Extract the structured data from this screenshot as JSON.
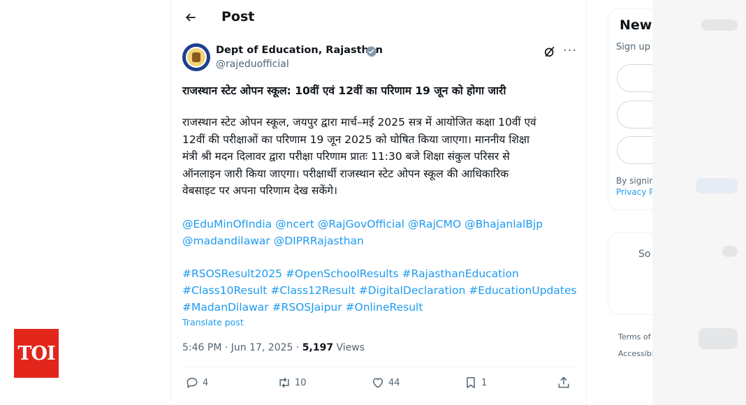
{
  "publisher": {
    "logo_text": "TOI"
  },
  "header": {
    "title": "Post"
  },
  "author": {
    "name": "Dept of Education, Rajasthan",
    "handle": "@rajeduofficial"
  },
  "tweet": {
    "title": "राजस्थान स्टेट ओपन स्कूल: 10वीं एवं 12वीं का परिणाम 19 जून को होगा जारी",
    "body_lines": [
      "राजस्थान स्टेट ओपन स्कूल, जयपुर द्वारा मार्च–मई 2025 सत्र में आयोजित कक्षा 10वीं एवं",
      "12वीं की परीक्षाओं का परिणाम 19 जून 2025 को घोषित किया जाएगा। माननीय शिक्षा",
      "मंत्री श्री मदन दिलावर द्वारा परीक्षा परिणाम प्रातः 11:30 बजे शिक्षा संकुल परिसर से",
      "ऑनलाइन जारी किया जाएगा। परीक्षार्थी राजस्थान स्टेट ओपन स्कूल की आधिकारिक",
      "वेबसाइट पर अपना परिणाम देख सकेंगे।"
    ],
    "mentions": [
      "@EduMinOfIndia",
      "@ncert",
      "@RajGovOfficial",
      "@RajCMO",
      "@BhajanlalBjp",
      "@madandilawar",
      "@DIPRRajasthan"
    ],
    "hashtags": [
      "#RSOSResult2025",
      "#OpenSchoolResults",
      "#RajasthanEducation",
      "#Class10Result",
      "#Class12Result",
      "#DigitalDeclaration",
      "#EducationUpdates",
      "#MadanDilawar",
      "#RSOSJaipur",
      "#OnlineResult"
    ],
    "translate_label": "Translate post",
    "timestamp": "5:46 PM · Jun 17, 2025 · ",
    "views_count": "5,197",
    "views_label": " Views"
  },
  "actions": {
    "replies": "4",
    "reposts": "10",
    "likes": "44",
    "bookmarks": "1"
  },
  "sidebar": {
    "signup_title": "New",
    "signup_subtitle": "Sign up r",
    "legal_line1": "By signin",
    "legal_line2": "Privacy P",
    "card2_text": "So",
    "footer_terms": "Terms of S",
    "footer_access": "Accessibi"
  },
  "colors": {
    "accent": "#1d9bf0",
    "toi_red": "#e3261c",
    "verified": "#829aab"
  }
}
